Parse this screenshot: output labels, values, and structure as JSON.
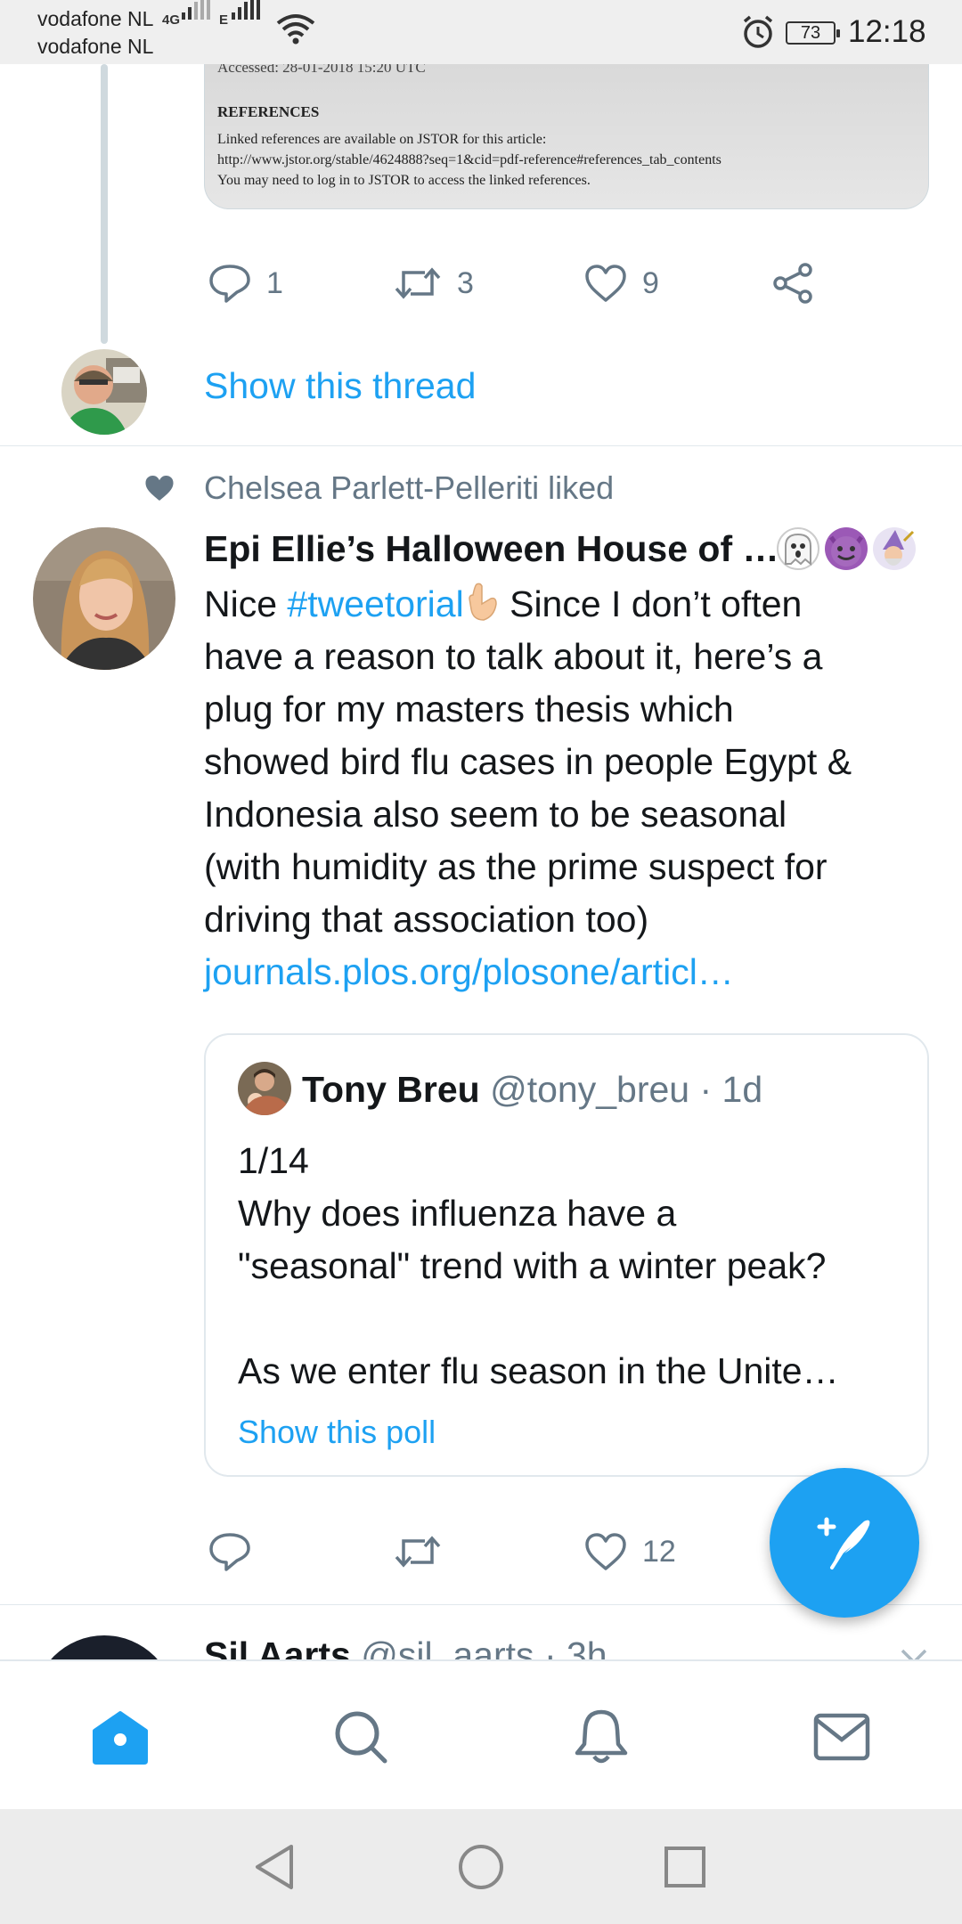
{
  "status_bar": {
    "carrier_1": "vodafone NL",
    "carrier_2": "vodafone NL",
    "network_1": "4G",
    "network_2": "E",
    "battery": "73",
    "time": "12:18"
  },
  "previous_tweet": {
    "image_text": {
      "accessed": "Accessed: 28-01-2018 15:20 UTC",
      "heading": "REFERENCES",
      "line1": "Linked references are available on JSTOR for this article:",
      "line2": "http://www.jstor.org/stable/4624888?seq=1&cid=pdf-reference#references_tab_contents",
      "line3": "You may need to log in to JSTOR to access the linked references."
    },
    "reply_count": "1",
    "retweet_count": "3",
    "like_count": "9",
    "show_thread": "Show this thread"
  },
  "liked_tweet": {
    "social_context": "Chelsea Parlett-Pelleriti liked",
    "author_name": "Epi Ellie’s Halloween House of …",
    "body": {
      "line1_a": "Nice ",
      "hashtag": "#tweetorial",
      "line1_b": " Since I don’t often",
      "line2": "have a reason to talk about it, here’s a",
      "line3": "plug for my masters thesis which",
      "line4": "showed bird flu cases in people Egypt &",
      "line5": "Indonesia also seem to be seasonal",
      "line6": "(with humidity as the prime suspect for",
      "line7": "driving that association too)",
      "link": "journals.plos.org/plosone/articl…"
    },
    "quote": {
      "author_name": "Tony Breu",
      "author_handle": "@tony_breu",
      "time": "· 1d",
      "line1": "1/14",
      "line2": "Why does influenza have a",
      "line3": "\"seasonal\" trend with a winter peak?",
      "line4": "As we enter flu season in the Unite…",
      "show_poll": "Show this poll"
    },
    "like_count": "12"
  },
  "next_tweet": {
    "author_name": "Sil Aarts",
    "author_handle": "@sil_aarts",
    "time": "· 3h"
  },
  "colors": {
    "accent": "#1da1f2",
    "secondary_text": "#657786",
    "divider": "#e1e8ed"
  },
  "icons": {
    "nav": [
      "home-icon",
      "search-icon",
      "bell-icon",
      "mail-icon"
    ],
    "system": [
      "back-icon",
      "home-circle-icon",
      "recents-icon"
    ]
  }
}
